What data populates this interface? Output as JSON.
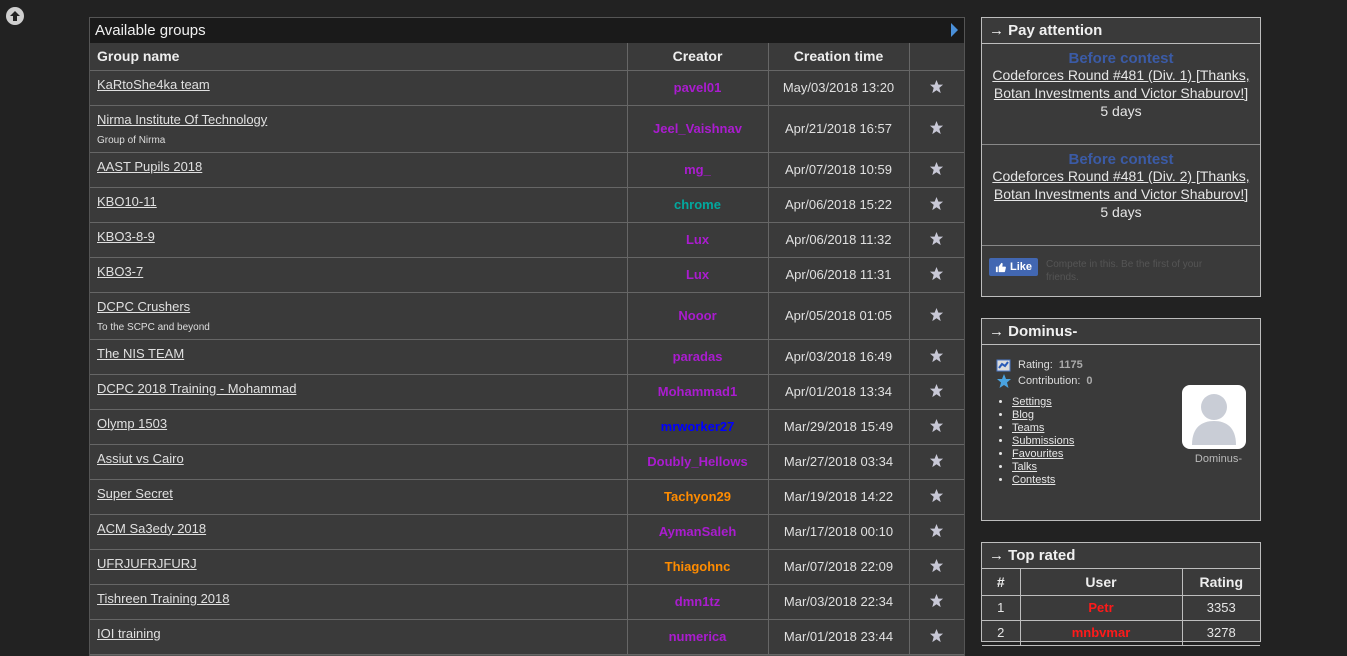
{
  "colors": {
    "purple": "#aa1ccf",
    "teal": "#03a89e",
    "blue": "#0000ff",
    "orange": "#ff8c00",
    "red": "#ff1a1a",
    "contest_heading": "#3b5ba6"
  },
  "groups": {
    "heading": "Available groups",
    "columns": {
      "name": "Group name",
      "creator": "Creator",
      "date": "Creation time"
    },
    "rows": [
      {
        "name": "KaRtoShe4ka team",
        "desc": "",
        "creator": "pavel01",
        "color": "#aa1ccf",
        "date": "May/03/2018 13:20"
      },
      {
        "name": "Nirma Institute Of Technology",
        "desc": "Group of Nirma",
        "creator": "Jeel_Vaishnav",
        "color": "#aa1ccf",
        "date": "Apr/21/2018 16:57"
      },
      {
        "name": "AAST Pupils 2018",
        "desc": "",
        "creator": "mg_",
        "color": "#aa1ccf",
        "date": "Apr/07/2018 10:59"
      },
      {
        "name": "KBO10-11",
        "desc": "",
        "creator": "chrome",
        "color": "#03a89e",
        "date": "Apr/06/2018 15:22"
      },
      {
        "name": "KBO3-8-9",
        "desc": "",
        "creator": "Lux",
        "color": "#aa1ccf",
        "date": "Apr/06/2018 11:32"
      },
      {
        "name": "KBO3-7",
        "desc": "",
        "creator": "Lux",
        "color": "#aa1ccf",
        "date": "Apr/06/2018 11:31"
      },
      {
        "name": "DCPC Crushers",
        "desc": "To the SCPC and beyond",
        "creator": "Nooor",
        "color": "#aa1ccf",
        "date": "Apr/05/2018 01:05"
      },
      {
        "name": "The NIS TEAM",
        "desc": "",
        "creator": "paradas",
        "color": "#aa1ccf",
        "date": "Apr/03/2018 16:49"
      },
      {
        "name": "DCPC 2018 Training - Mohammad",
        "desc": "",
        "creator": "Mohammad1",
        "color": "#aa1ccf",
        "date": "Apr/01/2018 13:34"
      },
      {
        "name": "Olymp 1503",
        "desc": "",
        "creator": "mrworker27",
        "color": "#0000ff",
        "date": "Mar/29/2018 15:49"
      },
      {
        "name": "Assiut vs Cairo",
        "desc": "",
        "creator": "Doubly_Hellows",
        "color": "#aa1ccf",
        "date": "Mar/27/2018 03:34"
      },
      {
        "name": "Super Secret",
        "desc": "",
        "creator": "Tachyon29",
        "color": "#ff8c00",
        "date": "Mar/19/2018 14:22"
      },
      {
        "name": "ACM Sa3edy 2018",
        "desc": "",
        "creator": "AymanSaleh",
        "color": "#aa1ccf",
        "date": "Mar/17/2018 00:10"
      },
      {
        "name": "UFRJUFRJFURJ",
        "desc": "",
        "creator": "Thiagohnc",
        "color": "#ff8c00",
        "date": "Mar/07/2018 22:09"
      },
      {
        "name": "Tishreen Training 2018",
        "desc": "",
        "creator": "dmn1tz",
        "color": "#aa1ccf",
        "date": "Mar/03/2018 22:34"
      },
      {
        "name": "IOI training",
        "desc": "",
        "creator": "numerica",
        "color": "#aa1ccf",
        "date": "Mar/01/2018 23:44"
      }
    ]
  },
  "pay_attention": {
    "title": "→ Pay attention",
    "contests": [
      {
        "label": "Before contest",
        "name": "Codeforces Round #481 (Div. 1) [Thanks, Botan Investments and Victor Shaburov!]",
        "days": "5 days"
      },
      {
        "label": "Before contest",
        "name": "Codeforces Round #481 (Div. 2) [Thanks, Botan Investments and Victor Shaburov!]",
        "days": "5 days"
      }
    ],
    "like_label": "Like",
    "like_text": "Compete in this. Be the first of your friends."
  },
  "user": {
    "title": "→ Dominus-",
    "rating_label": "Rating:",
    "rating": "1175",
    "contribution_label": "Contribution:",
    "contribution": "0",
    "links": [
      "Settings",
      "Blog",
      "Teams",
      "Submissions",
      "Favourites",
      "Talks",
      "Contests"
    ],
    "handle": "Dominus-"
  },
  "top_rated": {
    "title": "→ Top rated",
    "columns": [
      "#",
      "User",
      "Rating"
    ],
    "rows": [
      {
        "rank": "1",
        "user": "Petr",
        "rating": "3353"
      },
      {
        "rank": "2",
        "user": "mnbvmar",
        "rating": "3278"
      }
    ]
  }
}
